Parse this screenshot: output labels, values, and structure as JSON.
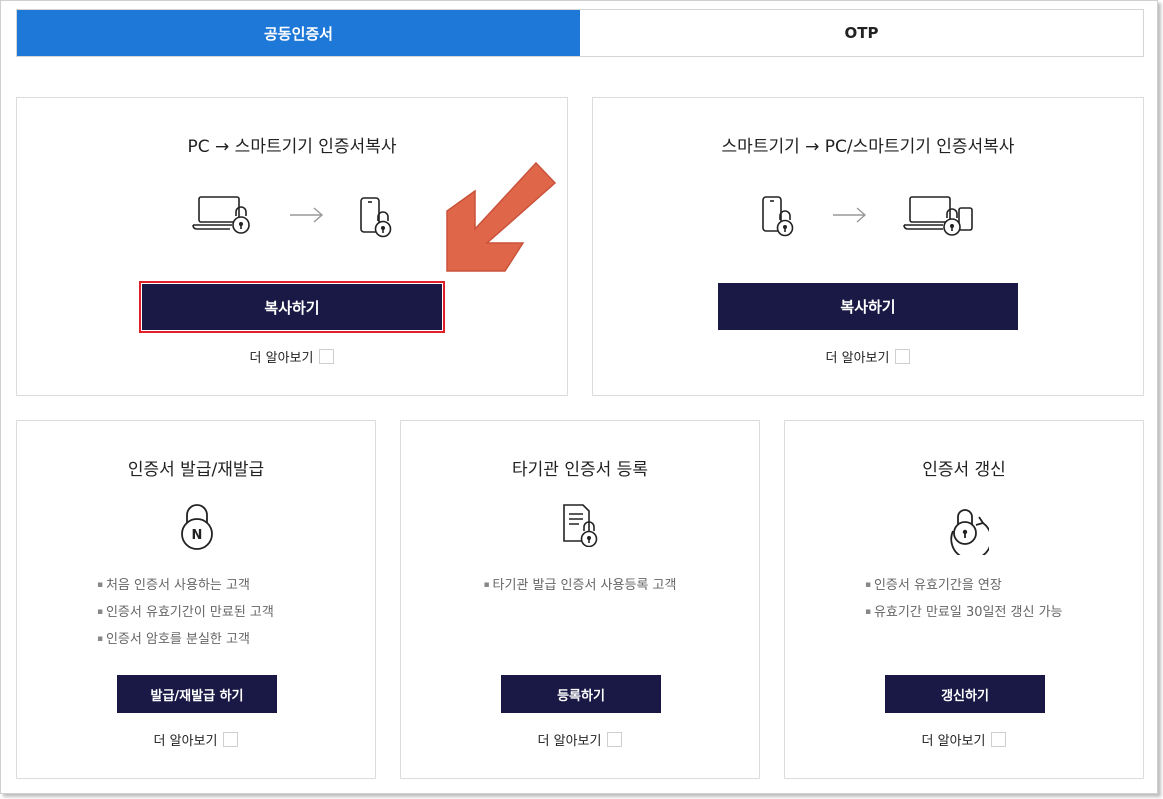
{
  "tabs": [
    {
      "label": "공동인증서",
      "active": true
    },
    {
      "label": "OTP",
      "active": false
    }
  ],
  "colors": {
    "accent": "#1e78d7",
    "button": "#1a1946",
    "highlight": "#e0202a",
    "pointer": "#e0664a"
  },
  "copy_pc": {
    "title": "PC → 스마트기기 인증서복사",
    "icons": [
      "laptop-lock-icon",
      "arrow-right-icon",
      "phone-lock-icon"
    ],
    "button": "복사하기",
    "more": "더 알아보기"
  },
  "copy_mobile": {
    "title": "스마트기기 → PC/스마트기기 인증서복사",
    "icons": [
      "phone-lock-icon",
      "arrow-right-icon",
      "laptop-phone-lock-icon"
    ],
    "button": "복사하기",
    "more": "더 알아보기"
  },
  "issue": {
    "title": "인증서 발급/재발급",
    "icon": "padlock-n-icon",
    "bullets": [
      "처음 인증서 사용하는 고객",
      "인증서 유효기간이 만료된 고객",
      "인증서 암호를 분실한 고객"
    ],
    "button": "발급/재발급 하기",
    "more": "더 알아보기"
  },
  "register": {
    "title": "타기관 인증서 등록",
    "icon": "document-lock-icon",
    "bullets": [
      "타기관 발급 인증서 사용등록 고객"
    ],
    "button": "등록하기",
    "more": "더 알아보기"
  },
  "renew": {
    "title": "인증서 갱신",
    "icon": "renew-lock-icon",
    "bullets": [
      "인증서 유효기간을 연장",
      "유효기간 만료일 30일전 갱신 가능"
    ],
    "button": "갱신하기",
    "more": "더 알아보기"
  }
}
